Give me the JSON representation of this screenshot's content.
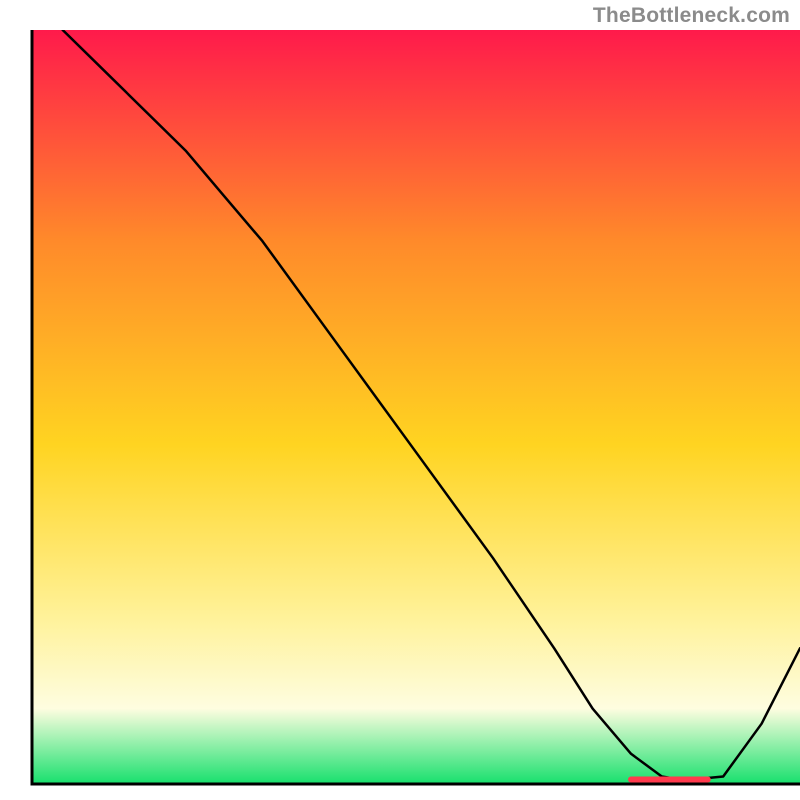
{
  "attribution": "TheBottleneck.com",
  "colors": {
    "gradient_top": "#ff1a4b",
    "gradient_mid_upper": "#ff8a2a",
    "gradient_mid": "#ffd421",
    "gradient_mid_lower": "#fff29a",
    "gradient_low": "#fefde0",
    "gradient_bottom": "#17e06d",
    "axis": "#000000",
    "curve": "#000000",
    "marker": "#ff3a4d"
  },
  "chart_data": {
    "type": "line",
    "title": "",
    "xlabel": "",
    "ylabel": "",
    "xlim": [
      0,
      100
    ],
    "ylim": [
      0,
      100
    ],
    "grid": false,
    "legend": false,
    "series": [
      {
        "name": "curve",
        "x": [
          4,
          10,
          20,
          25,
          30,
          40,
          50,
          60,
          68,
          73,
          78,
          82,
          85,
          90,
          95,
          100
        ],
        "y": [
          100,
          94,
          84,
          78,
          72,
          58,
          44,
          30,
          18,
          10,
          4,
          1,
          0.5,
          1,
          8,
          18
        ]
      }
    ],
    "marker_band": {
      "x_start": 78,
      "x_end": 88,
      "y": 0.6
    }
  }
}
